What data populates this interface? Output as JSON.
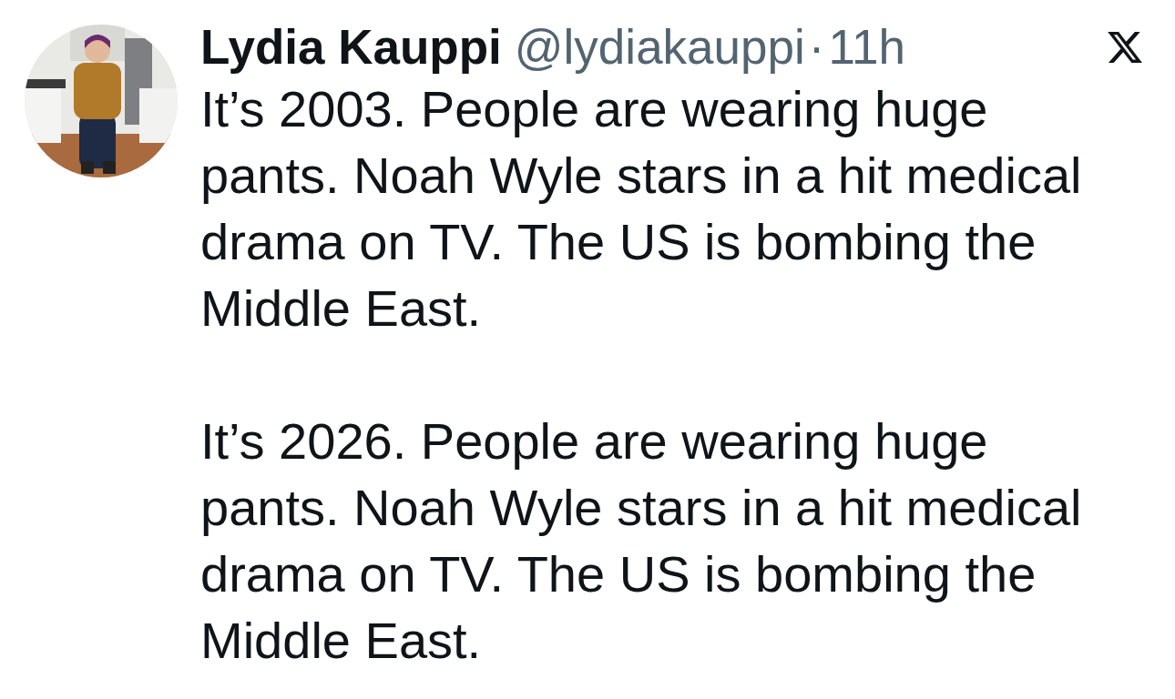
{
  "post": {
    "author": {
      "name": "Lydia Kauppi",
      "handle": "@lydiakauppi",
      "separator": "·",
      "time": "11h"
    },
    "paragraphs": [
      "It’s 2003. People are wearing huge pants. Noah Wyle stars in a hit medical drama on TV. The US is bombing the Middle East.",
      "It’s 2026. People are wearing huge pants. Noah Wyle stars in a hit medical drama on TV. The US is bombing the Middle East."
    ]
  }
}
